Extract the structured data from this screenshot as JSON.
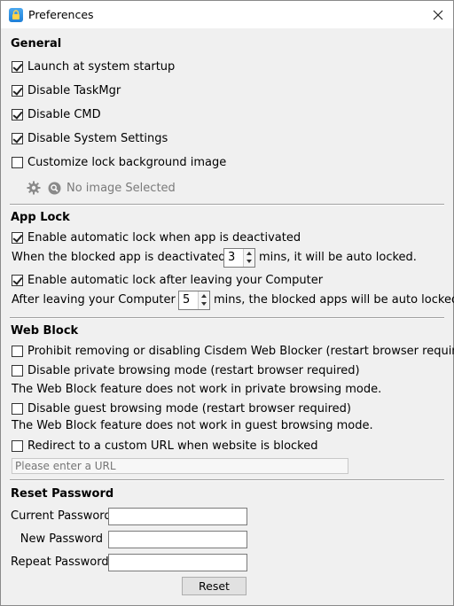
{
  "window": {
    "title": "Preferences"
  },
  "general": {
    "heading": "General",
    "launch_startup": {
      "label": "Launch at system startup",
      "checked": true
    },
    "disable_taskmgr": {
      "label": "Disable TaskMgr",
      "checked": true
    },
    "disable_cmd": {
      "label": "Disable CMD",
      "checked": true
    },
    "disable_system_settings": {
      "label": "Disable System Settings",
      "checked": true
    },
    "customize_background": {
      "label": "Customize lock background image",
      "checked": false
    },
    "no_image_text": "No image Selected"
  },
  "app_lock": {
    "heading": "App Lock",
    "auto_lock_deactivated": {
      "label": "Enable automatic lock when app is deactivated",
      "checked": true
    },
    "deactivated_prefix": "When the blocked app is deactivated for",
    "deactivated_minutes": "3",
    "deactivated_suffix": "mins, it will be auto locked.",
    "auto_lock_leaving": {
      "label": "Enable automatic lock after leaving your Computer",
      "checked": true
    },
    "leaving_prefix": "After leaving your Computer for",
    "leaving_minutes": "5",
    "leaving_suffix": "mins, the blocked apps will be auto locked."
  },
  "web_block": {
    "heading": "Web Block",
    "prohibit_removing": {
      "label": "Prohibit removing or disabling Cisdem Web Blocker (restart browser required)",
      "checked": false
    },
    "disable_private": {
      "label": "Disable private browsing mode (restart browser required)",
      "checked": false
    },
    "private_note": "The Web Block feature does not work in private browsing mode.",
    "disable_guest": {
      "label": "Disable guest browsing mode (restart browser required)",
      "checked": false
    },
    "guest_note": "The Web Block feature does not work in guest browsing mode.",
    "redirect_custom": {
      "label": "Redirect to a custom URL when website is blocked",
      "checked": false
    },
    "url_placeholder": "Please enter a URL"
  },
  "reset_password": {
    "heading": "Reset Password",
    "current_label": "Current Password",
    "new_label": "New Password",
    "repeat_label": "Repeat Password",
    "reset_button": "Reset"
  }
}
